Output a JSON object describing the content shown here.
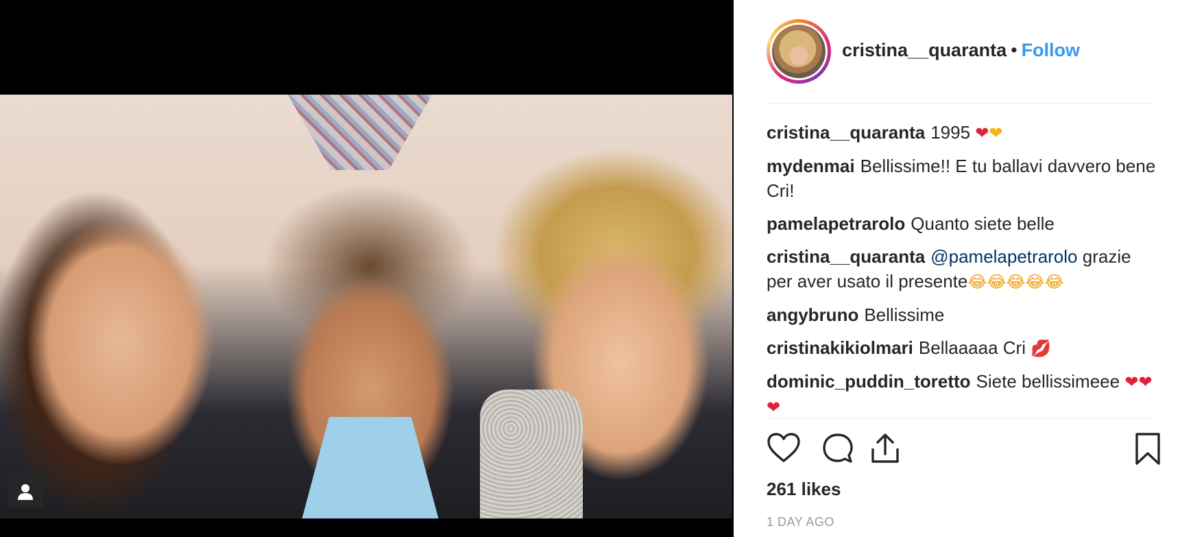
{
  "post": {
    "author": "cristina__quaranta",
    "separator": "•",
    "follow_label": "Follow",
    "likes": "261 likes",
    "age": "1 DAY AGO"
  },
  "comments": [
    {
      "user": "cristina__quaranta",
      "text": "1995",
      "emoji": [
        "red-heart",
        "yellow-heart"
      ]
    },
    {
      "user": "mydenmai",
      "text": "Bellissime!! E tu ballavi davvero bene Cri!"
    },
    {
      "user": "pamelapetrarolo",
      "text": "Quanto siete belle"
    },
    {
      "user": "cristina__quaranta",
      "mention": "@pamelapetrarolo",
      "text": "grazie per aver usato il presente",
      "emoji": [
        "tears-of-joy",
        "tears-of-joy",
        "tears-of-joy",
        "tears-of-joy",
        "tears-of-joy"
      ]
    },
    {
      "user": "angybruno",
      "text": "Bellissime"
    },
    {
      "user": "cristinakikiolmari",
      "text": "Bellaaaaa Cri",
      "emoji": [
        "kiss-mark"
      ]
    },
    {
      "user": "dominic_puddin_toretto",
      "text": "Siete bellissimeee",
      "emoji": [
        "red-heart",
        "red-heart",
        "red-heart"
      ]
    }
  ],
  "icons": {
    "like": "heart-outline-icon",
    "comment": "speech-bubble-icon",
    "share": "share-upload-icon",
    "save": "bookmark-outline-icon",
    "tagged": "person-tag-icon"
  },
  "colors": {
    "follow": "#3897f0",
    "mention": "#003569",
    "text": "#262626",
    "muted": "#999999"
  }
}
